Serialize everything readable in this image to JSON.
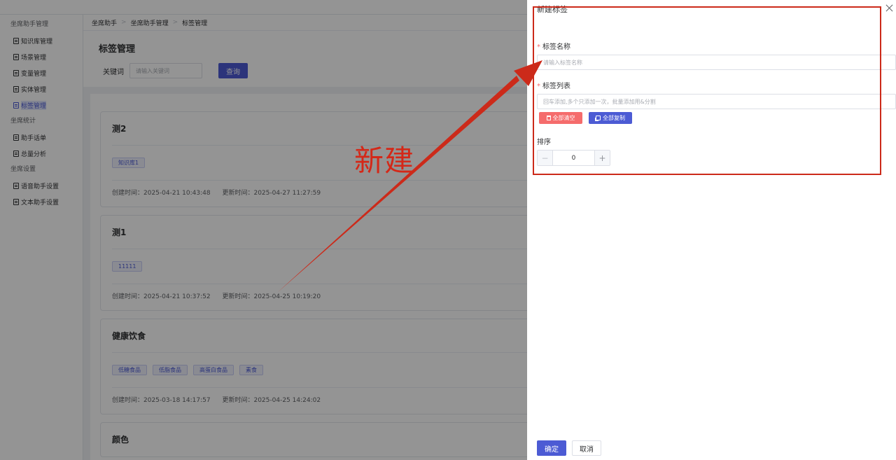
{
  "sidebar": {
    "groups": [
      {
        "label": "坐席助手管理",
        "items": [
          "知识库管理",
          "场景管理",
          "变量管理",
          "实体管理",
          "标签管理"
        ]
      },
      {
        "label": "坐席统计",
        "items": [
          "助手话单",
          "总量分析"
        ]
      },
      {
        "label": "坐席设置",
        "items": [
          "语音助手设置",
          "文本助手设置"
        ]
      }
    ],
    "active_item": "标签管理"
  },
  "breadcrumb": [
    "坐席助手",
    "坐席助手管理",
    "标签管理"
  ],
  "page": {
    "title": "标签管理",
    "keyword_label": "关键词",
    "keyword_placeholder": "请输入关键词",
    "query_label": "查询"
  },
  "cards": [
    {
      "title": "测2",
      "tags": [
        "知识库1"
      ],
      "created": "创建时间：2025-04-21 10:43:48",
      "updated": "更新时间：2025-04-27 11:27:59"
    },
    {
      "title": "测1",
      "tags": [
        "11111"
      ],
      "created": "创建时间：2025-04-21 10:37:52",
      "updated": "更新时间：2025-04-25 10:19:20"
    },
    {
      "title": "健康饮食",
      "tags": [
        "低糖食品",
        "低脂食品",
        "高蛋白食品",
        "素食"
      ],
      "created": "创建时间：2025-03-18 14:17:57",
      "updated": "更新时间：2025-04-25 14:24:02"
    },
    {
      "title": "颜色",
      "tags": [],
      "created": "",
      "updated": ""
    }
  ],
  "drawer": {
    "title": "新建标签",
    "name_label": "标签名称",
    "name_placeholder": "请输入标签名称",
    "list_label": "标签列表",
    "list_placeholder": "回车添加,多个只添加一次，批量添加用&分割",
    "clear_all": "全部清空",
    "copy_all": "全部复制",
    "sort_label": "排序",
    "sort_value": "0",
    "minus": "−",
    "plus": "+",
    "confirm": "确定",
    "cancel": "取消"
  },
  "annotation": {
    "text": "新建",
    "color": "#d42818"
  },
  "colors": {
    "primary": "#4c5bd4",
    "danger": "#f56c6c",
    "annotation_red": "#cc2a1a"
  }
}
